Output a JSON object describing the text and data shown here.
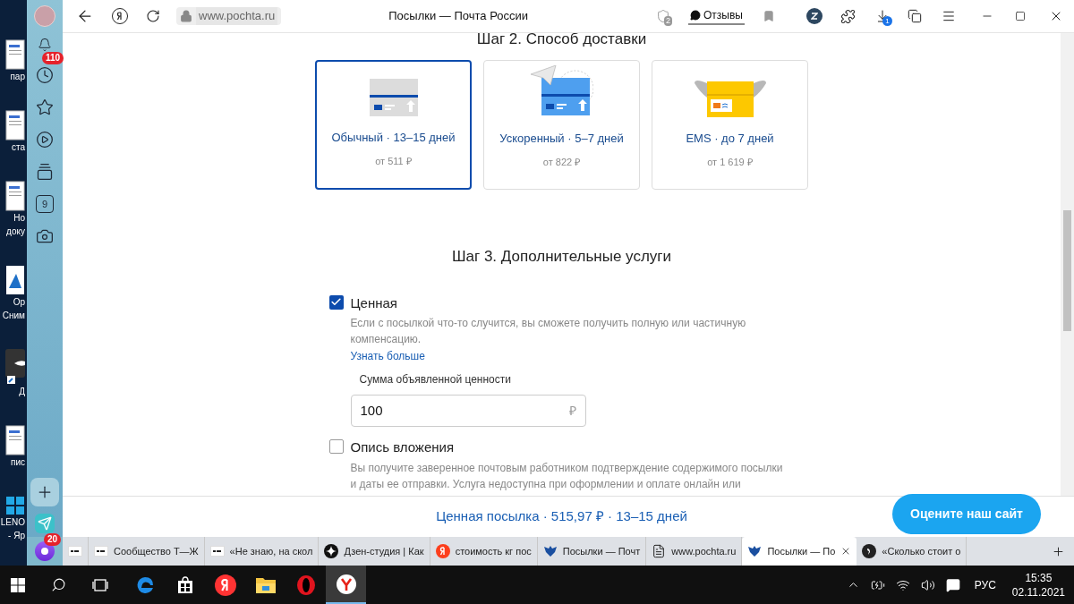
{
  "desktop": {
    "icons": [
      {
        "kind": "document",
        "lines": [
          "пар"
        ]
      },
      {
        "kind": "document",
        "lines": [
          "ста"
        ]
      },
      {
        "kind": "document",
        "lines": [
          "Но",
          "доку"
        ]
      },
      {
        "kind": "image",
        "lines": [
          "Ор",
          "Сним"
        ]
      },
      {
        "kind": "shortcut",
        "lines": [
          "Д"
        ]
      },
      {
        "kind": "document",
        "lines": [
          "пис"
        ]
      },
      {
        "kind": "app",
        "lines": [
          "LENO",
          "- Яр"
        ]
      }
    ]
  },
  "browser": {
    "address": "www.pochta.ru",
    "title": "Посылки — Почта России",
    "protect_badge": "2",
    "reviews": "Отзывы",
    "downloads_badge": "1"
  },
  "sidebar": {
    "items": [
      {
        "kind": "bell",
        "badge": "110"
      },
      {
        "kind": "clock"
      },
      {
        "kind": "star"
      },
      {
        "kind": "play"
      },
      {
        "kind": "cards"
      },
      {
        "kind": "counter",
        "text": "9"
      },
      {
        "kind": "camera"
      }
    ],
    "messenger_badge": "20"
  },
  "page": {
    "step2_title": "Шаг 2. Способ доставки",
    "delivery_options": [
      {
        "kind": "regular",
        "title": "Обычный · 13–15 дней",
        "price": "от 511 ₽",
        "selected": true
      },
      {
        "kind": "express",
        "title": "Ускоренный · 5–7 дней",
        "price": "от 822 ₽",
        "selected": false
      },
      {
        "kind": "ems",
        "title": "EMS · до 7 дней",
        "price": "от 1 619 ₽",
        "selected": false
      }
    ],
    "step3_title": "Шаг 3. Дополнительные услуги",
    "services": [
      {
        "label": "Ценная",
        "checked": true,
        "description": "Если с посылкой что-то случится, вы сможете получить полную или частичную компенсацию.",
        "link": "Узнать больше",
        "field": {
          "label": "Сумма объявленной ценности",
          "value": "100",
          "currency": "₽"
        }
      },
      {
        "label": "Опись вложения",
        "checked": false,
        "description": "Вы получите заверенное почтовым работником подтверждение содержимого посылки и даты ее отправки. Услуга недоступна при оформлении и оплате онлайн или"
      }
    ],
    "summary": "Ценная посылка · 515,97 ₽ · 13–15 дней",
    "rate_button": "Оцените наш сайт"
  },
  "tabs": [
    {
      "kind": "tj",
      "selected": false
    },
    {
      "kind": "tj",
      "title": "Сообщество Т—Ж",
      "selected": false
    },
    {
      "kind": "tj",
      "title": "«Не знаю, на скол",
      "selected": false
    },
    {
      "kind": "zen",
      "title": "Дзен-студия | Как",
      "selected": false
    },
    {
      "kind": "yandex",
      "title": "стоимость кг пос",
      "selected": false
    },
    {
      "kind": "pochta",
      "title": "Посылки — Почт",
      "selected": false
    },
    {
      "kind": "doc",
      "title": "www.pochta.ru",
      "selected": false
    },
    {
      "kind": "pochta",
      "title": "Посылки — По",
      "selected": true
    },
    {
      "kind": "quote",
      "title": "«Сколько стоит о",
      "selected": false
    }
  ],
  "taskbar": {
    "apps": [
      {
        "kind": "edge",
        "selected": false
      },
      {
        "kind": "store",
        "selected": false
      },
      {
        "kind": "yandex",
        "selected": false
      },
      {
        "kind": "explorer",
        "selected": false
      },
      {
        "kind": "opera",
        "selected": false
      },
      {
        "kind": "ybrowser",
        "selected": true
      }
    ],
    "language": "РУС",
    "time": "15:35",
    "date": "02.11.2021"
  }
}
